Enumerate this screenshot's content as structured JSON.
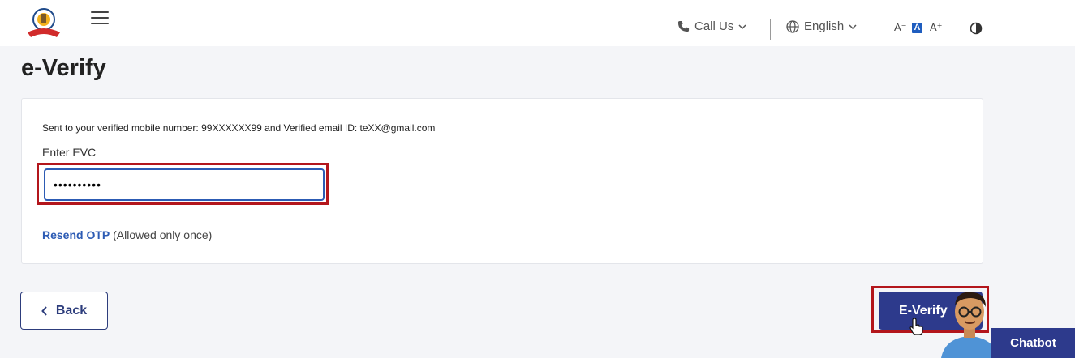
{
  "header": {
    "call_us": "Call Us",
    "language": "English",
    "font_decrease": "A⁻",
    "font_normal": "A",
    "font_increase": "A⁺"
  },
  "page": {
    "title": "e-Verify"
  },
  "form": {
    "sent_message": "Sent to your verified mobile number: 99XXXXXX99 and Verified email ID: teXX@gmail.com",
    "evc_label": "Enter EVC",
    "evc_value": "••••••••••",
    "resend_link": "Resend OTP",
    "resend_note": "(Allowed only once)"
  },
  "footer": {
    "back_label": "Back",
    "everify_label": "E-Verify",
    "chatbot_label": "Chatbot"
  },
  "colors": {
    "primary": "#2d3a8c",
    "link": "#2c5bb4",
    "highlight": "#b3161c"
  }
}
